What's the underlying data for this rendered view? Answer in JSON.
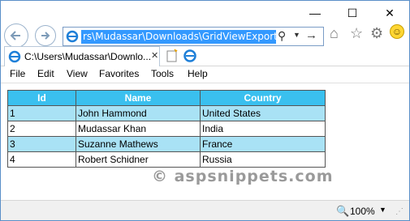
{
  "window": {
    "minimize_glyph": "—",
    "maximize_glyph": "☐",
    "close_glyph": "✕"
  },
  "address_bar": {
    "url_visible": "rs\\Mudassar\\Downloads\\GridViewExport.htm"
  },
  "icons": {
    "back": "back-arrow-icon",
    "forward": "forward-arrow-icon",
    "home": "home-icon",
    "favorites": "star-icon",
    "tools": "gear-icon",
    "feedback": "smiley-icon"
  },
  "tab": {
    "label": "C:\\Users\\Mudassar\\Downlo..."
  },
  "menu": [
    "File",
    "Edit",
    "View",
    "Favorites",
    "Tools",
    "Help"
  ],
  "grid": {
    "headers": [
      "Id",
      "Name",
      "Country"
    ],
    "rows": [
      [
        "1",
        "John Hammond",
        "United States"
      ],
      [
        "2",
        "Mudassar Khan",
        "India"
      ],
      [
        "3",
        "Suzanne Mathews",
        "France"
      ],
      [
        "4",
        "Robert Schidner",
        "Russia"
      ]
    ]
  },
  "watermark": "© aspsnippets.com",
  "status": {
    "zoom": "100%"
  },
  "colors": {
    "header_bg": "#3ac0ef",
    "alt_row_bg": "#a9e2f5",
    "selection": "#3399ff"
  }
}
